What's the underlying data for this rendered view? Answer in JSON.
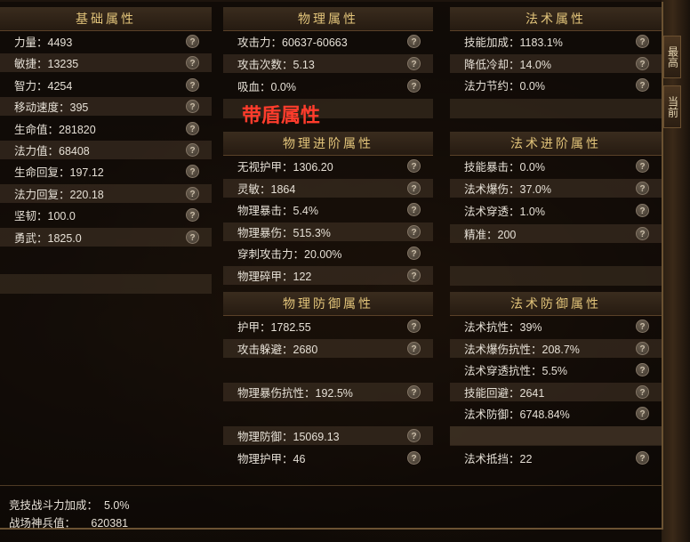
{
  "side_tabs": [
    "最高",
    "当前"
  ],
  "headers": {
    "basic": "基础属性",
    "phys": "物理属性",
    "magic": "法术属性",
    "phys_adv": "物理进阶属性",
    "magic_adv": "法术进阶属性",
    "phys_def": "物理防御属性",
    "magic_def": "法术防御属性"
  },
  "help_glyph": "?",
  "shield_title": "带盾属性",
  "basic": [
    "力量：4493",
    "敏捷：13235",
    "智力：4254",
    "移动速度：395",
    "生命值：281820",
    "法力值：68408",
    "生命回复：197.12",
    "法力回复：220.18",
    "坚韧：100.0",
    "勇武：1825.0"
  ],
  "phys": [
    "攻击力：60637-60663",
    "攻击次数：5.13",
    "吸血：0.0%"
  ],
  "magic": [
    "技能加成：1183.1%",
    "降低冷却：14.0%",
    "法力节约：0.0%"
  ],
  "phys_adv": [
    "无视护甲：1306.20",
    "灵敏：1864",
    "物理暴击：5.4%",
    "物理暴伤：515.3%",
    "穿刺攻击力：20.00%",
    "物理碎甲：122"
  ],
  "magic_adv": [
    "技能暴击：0.0%",
    "法术爆伤：37.0%",
    "法术穿透：1.0%",
    "精准：200"
  ],
  "phys_def": [
    "护甲：1782.55",
    "攻击躲避：2680",
    "",
    "物理暴伤抗性：192.5%",
    "",
    "物理防御：15069.13",
    "物理护甲：46"
  ],
  "magic_def": [
    "法术抗性：39%",
    "法术爆伤抗性：208.7%",
    "法术穿透抗性：5.5%",
    "技能回避：2641",
    "法术防御：6748.84%",
    "",
    "法术抵挡：22"
  ],
  "bottom": {
    "arena_label": "竞技战斗力加成：",
    "arena_value": "5.0%",
    "battlefield_label": "战场神兵值：",
    "battlefield_value": "620381"
  }
}
